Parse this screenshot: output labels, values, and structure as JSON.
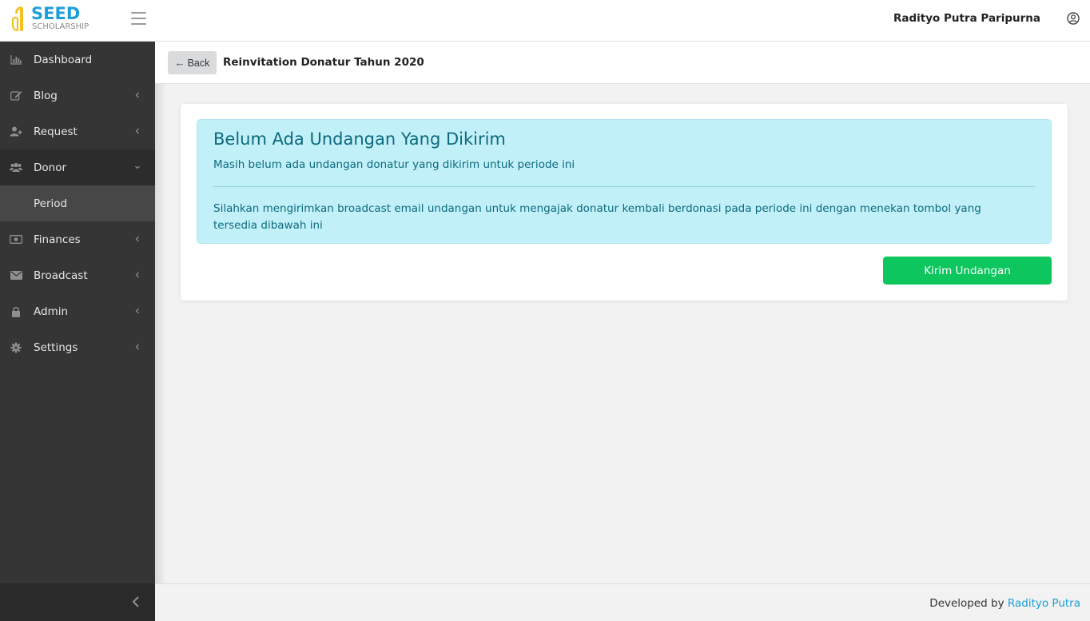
{
  "brand": {
    "line1": "SEED",
    "line2": "SCHOLARSHIP",
    "primary_color": "#1e9fd8",
    "mark_color": "#f4c21f"
  },
  "header": {
    "user_name": "Radityo Putra Paripurna",
    "menu_icon": "hamburger-icon",
    "user_icon": "user-circle-icon"
  },
  "sidebar": {
    "items": [
      {
        "label": "Dashboard",
        "icon": "bar-chart-icon",
        "has_chevron": false
      },
      {
        "label": "Blog",
        "icon": "edit-icon",
        "has_chevron": true
      },
      {
        "label": "Request",
        "icon": "user-plus-icon",
        "has_chevron": true
      },
      {
        "label": "Donor",
        "icon": "users-icon",
        "has_chevron": true,
        "expanded": true
      },
      {
        "label": "Period",
        "sub": true
      },
      {
        "label": "Finances",
        "icon": "money-icon",
        "has_chevron": true
      },
      {
        "label": "Broadcast",
        "icon": "envelope-icon",
        "has_chevron": true
      },
      {
        "label": "Admin",
        "icon": "lock-icon",
        "has_chevron": true
      },
      {
        "label": "Settings",
        "icon": "gear-icon",
        "has_chevron": true
      }
    ]
  },
  "subheader": {
    "back_label": "Back",
    "title": "Reinvitation Donatur Tahun 2020"
  },
  "alert": {
    "heading": "Belum Ada Undangan Yang Dikirim",
    "subtitle": "Masih belum ada undangan donatur yang dikirim untuk periode ini",
    "body": "Silahkan mengirimkan broadcast email undangan untuk mengajak donatur kembali berdonasi pada periode ini dengan menekan tombol yang tersedia dibawah ini"
  },
  "actions": {
    "send_label": "Kirim Undangan"
  },
  "footer": {
    "prefix": "Developed by",
    "link": "Radityo Putra"
  }
}
